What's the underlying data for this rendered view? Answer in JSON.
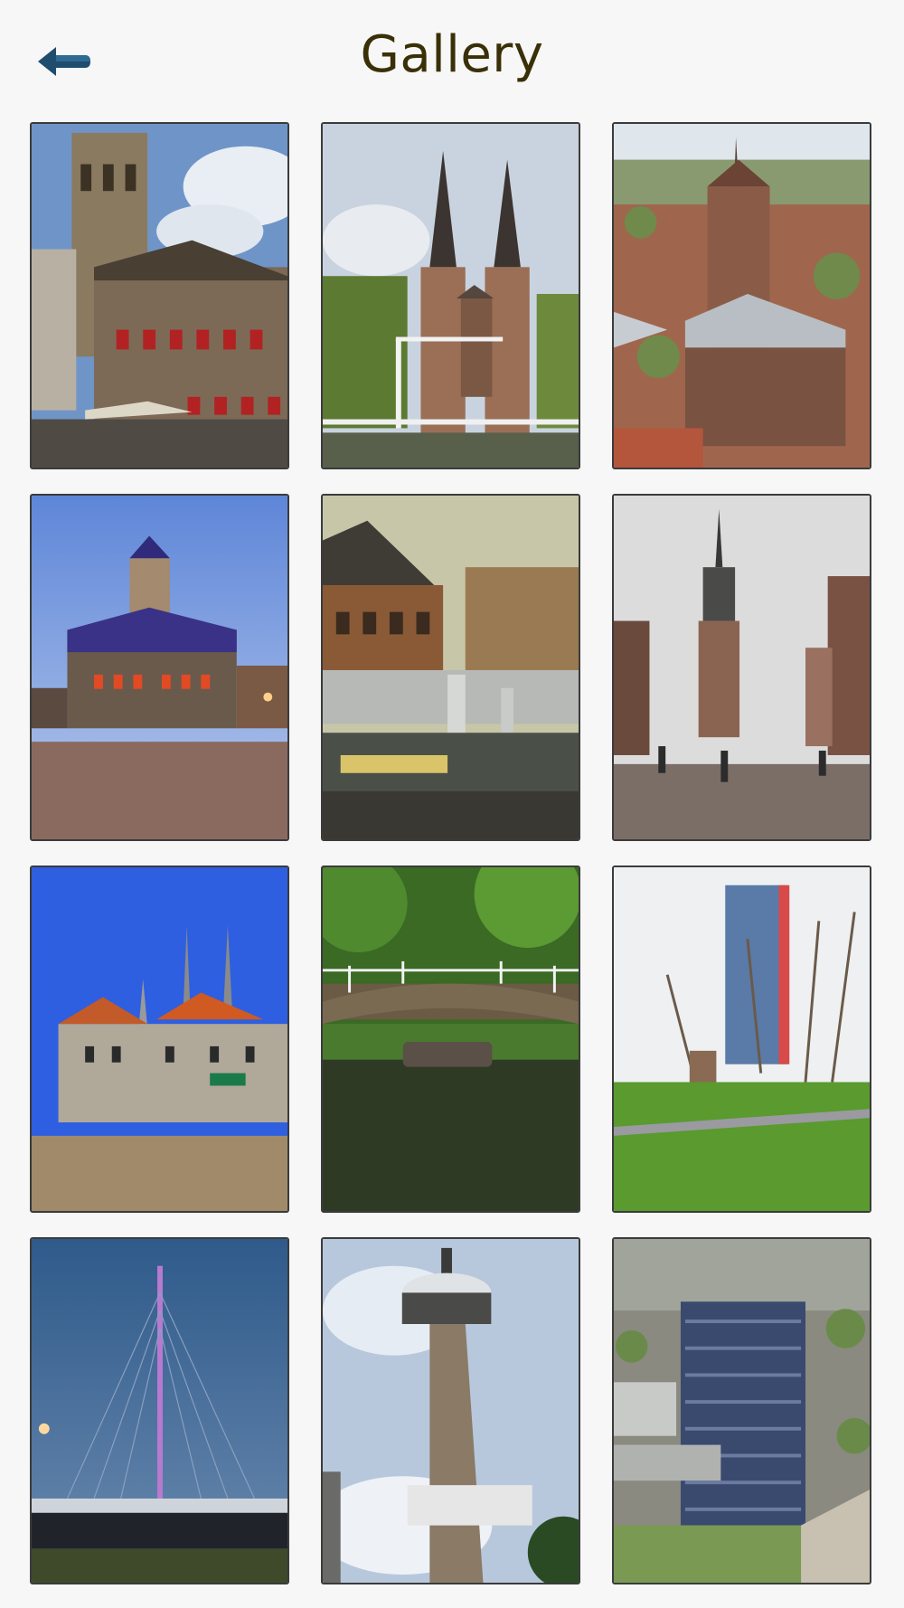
{
  "header": {
    "title": "Gallery",
    "back_icon": "arrow-left-icon"
  },
  "gallery": {
    "items": [
      {
        "id": "photo-1",
        "subject": "tower-building"
      },
      {
        "id": "photo-2",
        "subject": "twin-tower-gate"
      },
      {
        "id": "photo-3",
        "subject": "church-aerial"
      },
      {
        "id": "photo-4",
        "subject": "town-hall-night"
      },
      {
        "id": "photo-5",
        "subject": "industrial-canal"
      },
      {
        "id": "photo-6",
        "subject": "church-street"
      },
      {
        "id": "photo-7",
        "subject": "market-square"
      },
      {
        "id": "photo-8",
        "subject": "canal-bridge"
      },
      {
        "id": "photo-9",
        "subject": "park-tower"
      },
      {
        "id": "photo-10",
        "subject": "cable-bridge-dusk"
      },
      {
        "id": "photo-11",
        "subject": "observation-tower"
      },
      {
        "id": "photo-12",
        "subject": "campus-aerial"
      }
    ]
  },
  "colors": {
    "background": "#f7f7f7",
    "title": "#3a3008",
    "back_arrow": "#1e4d6e",
    "tile_border": "#3b3b3b"
  }
}
